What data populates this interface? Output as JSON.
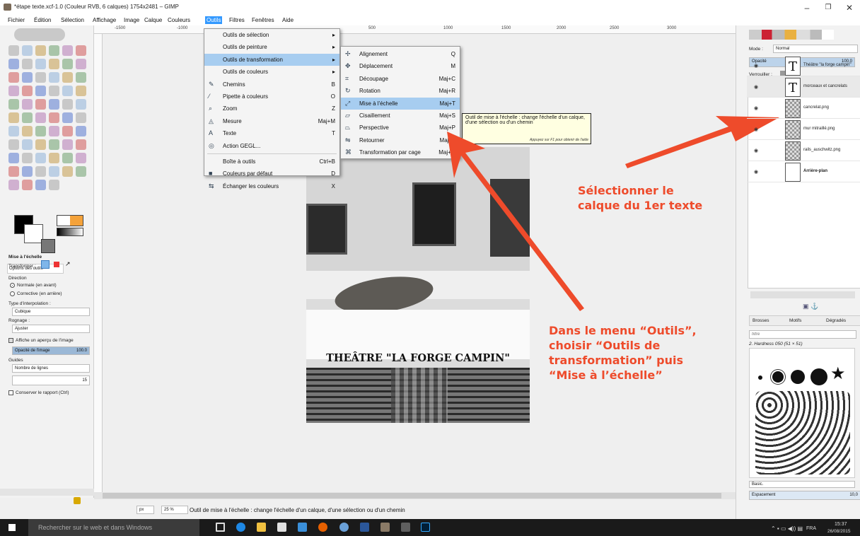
{
  "window": {
    "title": "*étape texte.xcf-1.0 (Couleur RVB, 6 calques) 1754x2481 – GIMP",
    "min": "–",
    "max": "❐",
    "close": "✕"
  },
  "menubar": [
    "Fichier",
    "Édition",
    "Sélection",
    "Affichage",
    "Image",
    "Calque",
    "Couleurs",
    "Outils",
    "Filtres",
    "Fenêtres",
    "Aide"
  ],
  "outils_menu": [
    {
      "label": "Outils de sélection",
      "shortcut": "",
      "icon": "",
      "sub": true
    },
    {
      "label": "Outils de peinture",
      "shortcut": "",
      "icon": "",
      "sub": true
    },
    {
      "label": "Outils de transformation",
      "shortcut": "",
      "icon": "",
      "sub": true,
      "active": true
    },
    {
      "label": "Outils de couleurs",
      "shortcut": "",
      "icon": "",
      "sub": true
    },
    {
      "label": "Chemins",
      "shortcut": "B",
      "icon": "✎"
    },
    {
      "label": "Pipette à couleurs",
      "shortcut": "O",
      "icon": "⁄"
    },
    {
      "label": "Zoom",
      "shortcut": "Z",
      "icon": "⌕"
    },
    {
      "label": "Mesure",
      "shortcut": "Maj+M",
      "icon": "◬"
    },
    {
      "label": "Texte",
      "shortcut": "T",
      "icon": "A"
    },
    {
      "label": "Action GEGL...",
      "shortcut": "",
      "icon": "◎"
    },
    {
      "label": "Boîte à outils",
      "shortcut": "Ctrl+B",
      "icon": ""
    },
    {
      "label": "Couleurs par défaut",
      "shortcut": "D",
      "icon": "■"
    },
    {
      "label": "Échanger les couleurs",
      "shortcut": "X",
      "icon": "⇆"
    }
  ],
  "transfo_menu": [
    {
      "label": "Alignement",
      "shortcut": "Q",
      "icon": "✢"
    },
    {
      "label": "Déplacement",
      "shortcut": "M",
      "icon": "✥"
    },
    {
      "label": "Découpage",
      "shortcut": "Maj+C",
      "icon": "⌗"
    },
    {
      "label": "Rotation",
      "shortcut": "Maj+R",
      "icon": "↻"
    },
    {
      "label": "Mise à l'échelle",
      "shortcut": "Maj+T",
      "icon": "⤢",
      "highlight": true
    },
    {
      "label": "Cisaillement",
      "shortcut": "Maj+S",
      "icon": "▱"
    },
    {
      "label": "Perspective",
      "shortcut": "Maj+P",
      "icon": "⏢"
    },
    {
      "label": "Retourner",
      "shortcut": "Maj+F",
      "icon": "⇋"
    },
    {
      "label": "Transformation par cage",
      "shortcut": "Maj+G",
      "icon": "⌘"
    }
  ],
  "tooltip": {
    "text": "Outil de mise à l'échelle : change l'échelle d'un calque, d'une sélection ou d'un chemin",
    "hint": "Appuyez sur F1 pour obtenir de l'aide"
  },
  "ruler": [
    "-1500",
    "-1000",
    "500",
    "1000",
    "1500",
    "2000",
    "2500",
    "3000"
  ],
  "tool_options": {
    "tab": "Options des outils",
    "heading": "Mise à l'échelle",
    "transform_label": "Transformer :",
    "direction_label": "Direction",
    "dir_normal": "Normale (en avant)",
    "dir_corrective": "Corrective (en arrière)",
    "interp_label": "Type d'interpolation :",
    "interp_value": "Cubique",
    "clip_label": "Rognage :",
    "clip_value": "Ajuster",
    "preview_label": "Affiche un aperçu de l'image",
    "opacity_label": "Opacité de l'image",
    "opacity_value": "100.0",
    "guides_label": "Guides",
    "guides_value": "Nombre de lignes",
    "guides_number": "15",
    "keep_ratio": "Conserver le rapport (Ctrl)"
  },
  "image": {
    "title_text": "THEÂTRE \"LA FORGE CAMPIN\""
  },
  "status": {
    "unit": "px",
    "zoom": "25 %",
    "message": "Outil de mise à l'échelle : change l'échelle d'un calque, d'une sélection ou d'un chemin"
  },
  "layers": {
    "mode_label": "Mode :",
    "mode_value": "Normal",
    "opacity_label": "Opacité",
    "opacity_value": "100,0",
    "lock_label": "Verrouiller :",
    "items": [
      {
        "name": "Théâtre \"la forge campin\"",
        "type": "text"
      },
      {
        "name": "morceaux et cancrelats",
        "type": "text"
      },
      {
        "name": "cancrelat.png",
        "type": "image"
      },
      {
        "name": "mur mitraillé.png",
        "type": "image"
      },
      {
        "name": "rails_auschwitz.png",
        "type": "image"
      },
      {
        "name": "Arrière-plan",
        "type": "bg",
        "bold": true
      }
    ]
  },
  "brushes": {
    "tabs": [
      "Brosses",
      "Motifs",
      "Dégradés"
    ],
    "filter_placeholder": "filtre",
    "current": "2. Hardness 050 (51 × 51)",
    "preset": "Basic.",
    "spacing_label": "Espacement",
    "spacing_value": "10,0"
  },
  "annotations": {
    "select": [
      "Sélectionner le",
      "calque du 1er texte"
    ],
    "menu": [
      "Dans le menu “Outils”,",
      "choisir “Outils de",
      "transformation” puis",
      "“Mise à l’échelle”"
    ],
    "color": "#ee4b2b"
  },
  "taskbar": {
    "search": "Rechercher sur le web et dans Windows",
    "lang": "FRA",
    "time": "15:37",
    "date": "26/08/2015"
  }
}
